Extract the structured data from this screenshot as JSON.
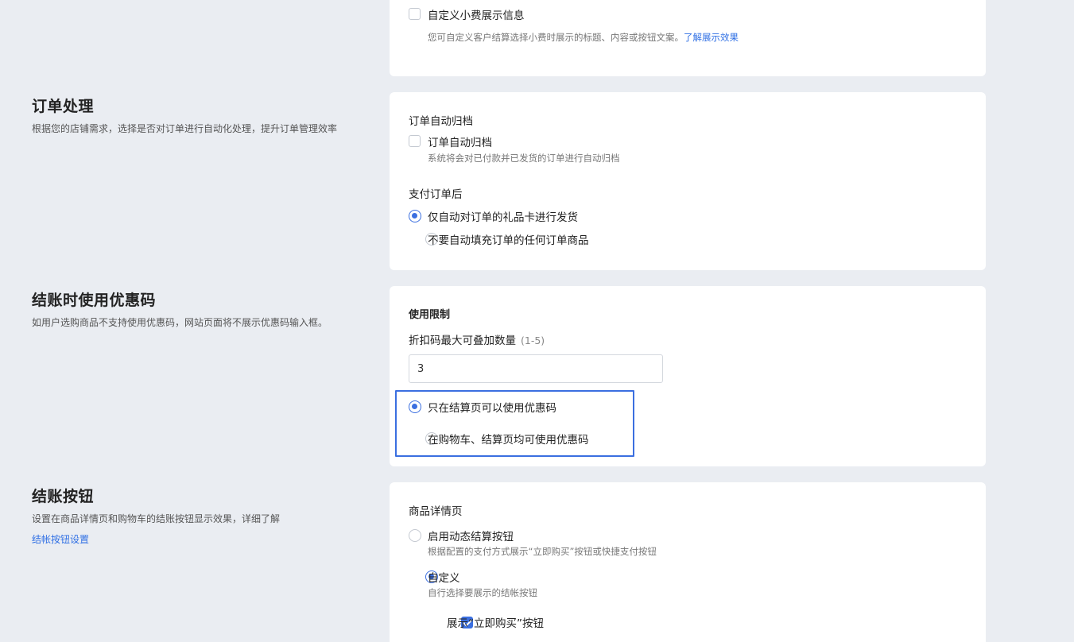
{
  "tip_section": {
    "checkbox_label": "自定义小费展示信息",
    "hint": "您可自定义客户结算选择小费时展示的标题、内容或按钮文案。",
    "hint_link": "了解展示效果"
  },
  "order_processing": {
    "title": "订单处理",
    "description": "根据您的店铺需求，选择是否对订单进行自动化处理，提升订单管理效率",
    "archive_heading": "订单自动归档",
    "archive_checkbox_label": "订单自动归档",
    "archive_hint": "系统将会对已付款并已发货的订单进行自动归档",
    "after_payment_heading": "支付订单后",
    "radio_giftcard": "仅自动对订单的礼品卡进行发货",
    "radio_none": "不要自动填充订单的任何订单商品"
  },
  "coupon_section": {
    "title": "结账时使用优惠码",
    "description": "如用户选购商品不支持使用优惠码，网站页面将不展示优惠码输入框。",
    "limit_heading": "使用限制",
    "max_stack_label": "折扣码最大可叠加数量",
    "max_stack_range": "(1-5)",
    "max_stack_value": "3",
    "radio_checkout_only": "只在结算页可以使用优惠码",
    "radio_cart_and_checkout": "在购物车、结算页均可使用优惠码"
  },
  "checkout_button_section": {
    "title": "结账按钮",
    "description": "设置在商品详情页和购物车的结账按钮显示效果，详细了解",
    "link": "结帐按钮设置",
    "product_page_heading": "商品详情页",
    "radio_dynamic": "启用动态结算按钮",
    "radio_dynamic_hint": "根据配置的支付方式展示“立即购买”按钮或快捷支付按钮",
    "radio_custom": "自定义",
    "radio_custom_hint": "自行选择要展示的结帐按钮",
    "checkbox_buy_now": "展示“立即购买”按钮"
  },
  "colors": {
    "accent": "#3b6fe0",
    "page_background": "#eaedf2",
    "card_background": "#ffffff"
  }
}
